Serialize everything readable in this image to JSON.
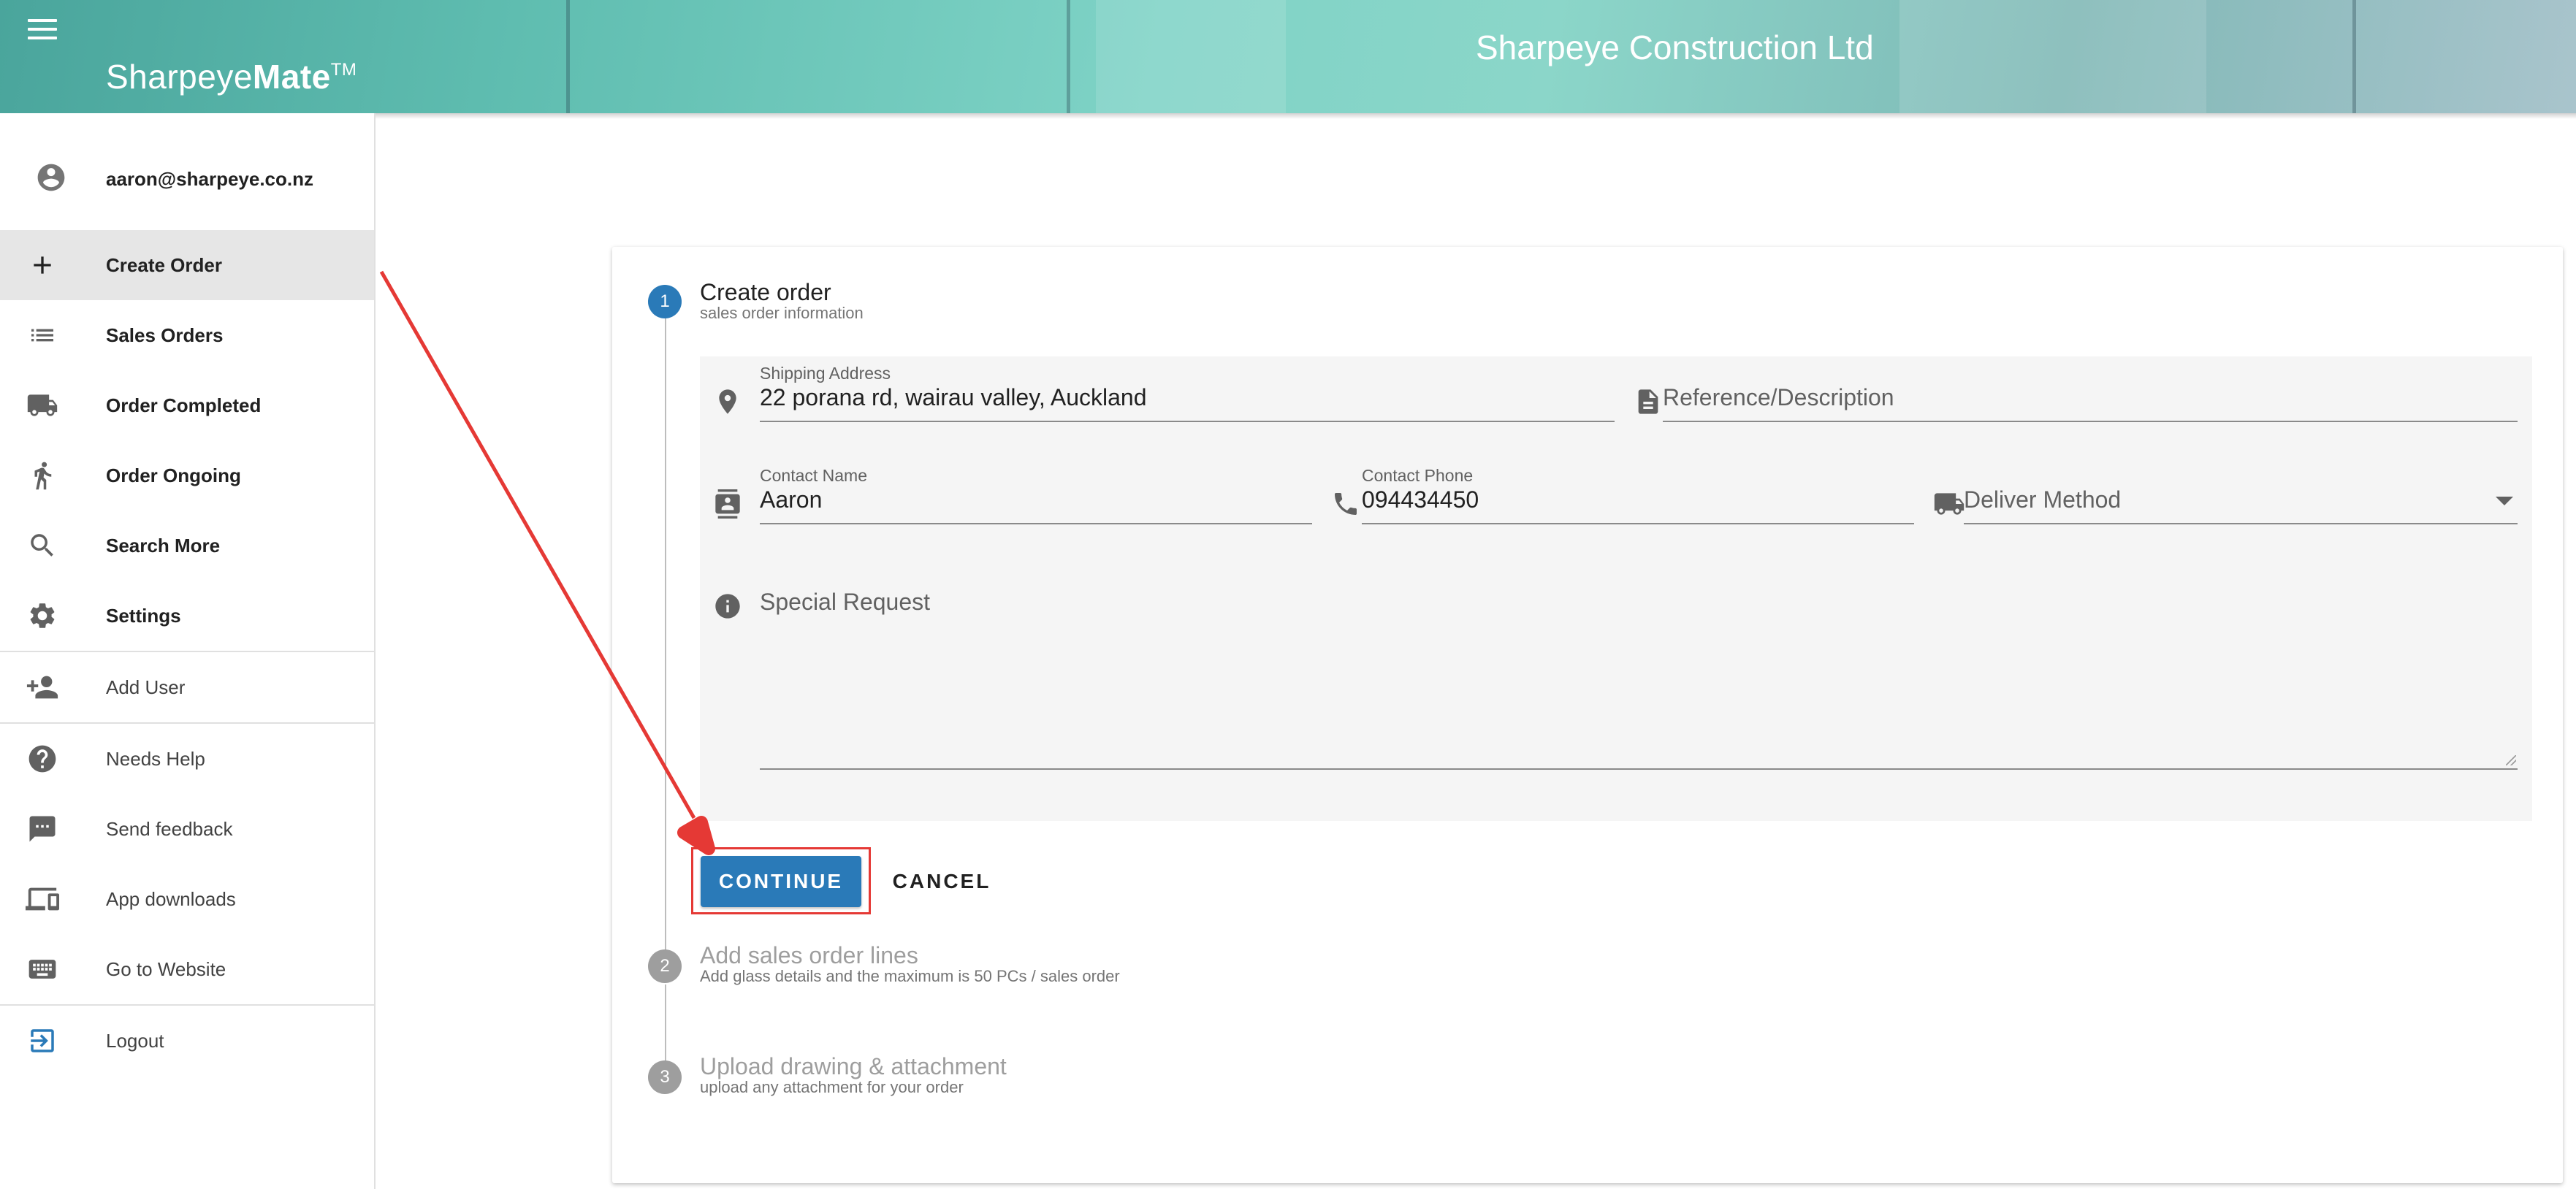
{
  "header": {
    "brand_light": "Sharpeye",
    "brand_bold": "Mate",
    "brand_tm": "TM",
    "company": "Sharpeye Construction Ltd"
  },
  "sidebar": {
    "user_email": "aaron@sharpeye.co.nz",
    "items": [
      {
        "label": "Create Order",
        "icon": "plus-icon",
        "active": true
      },
      {
        "label": "Sales Orders",
        "icon": "list-icon"
      },
      {
        "label": "Order Completed",
        "icon": "truck-icon"
      },
      {
        "label": "Order Ongoing",
        "icon": "walking-icon"
      },
      {
        "label": "Search More",
        "icon": "search-icon"
      },
      {
        "label": "Settings",
        "icon": "gear-icon"
      },
      {
        "label": "Add User",
        "icon": "add-user-icon"
      },
      {
        "label": "Needs Help",
        "icon": "help-icon"
      },
      {
        "label": "Send feedback",
        "icon": "feedback-icon"
      },
      {
        "label": "App downloads",
        "icon": "devices-icon"
      },
      {
        "label": "Go to Website",
        "icon": "keyboard-icon"
      },
      {
        "label": "Logout",
        "icon": "logout-icon"
      }
    ]
  },
  "stepper": {
    "steps": [
      {
        "number": "1",
        "title": "Create order",
        "subtitle": "sales order information"
      },
      {
        "number": "2",
        "title": "Add sales order lines",
        "subtitle": "Add glass details and the maximum is 50 PCs / sales order"
      },
      {
        "number": "3",
        "title": "Upload drawing & attachment",
        "subtitle": "upload any attachment for your order"
      }
    ]
  },
  "form": {
    "shipping_address": {
      "label": "Shipping Address",
      "value": "22 porana rd, wairau valley, Auckland"
    },
    "reference": {
      "placeholder": "Reference/Description"
    },
    "contact_name": {
      "label": "Contact Name",
      "value": "Aaron"
    },
    "contact_phone": {
      "label": "Contact Phone",
      "value": "094434450"
    },
    "deliver_method": {
      "placeholder": "Deliver Method"
    },
    "special_request": {
      "placeholder": "Special Request"
    }
  },
  "actions": {
    "continue_label": "CONTINUE",
    "cancel_label": "CANCEL"
  },
  "colors": {
    "primary": "#2a7ab8",
    "annotation": "#e53935",
    "inactive_step": "#9e9e9e"
  }
}
